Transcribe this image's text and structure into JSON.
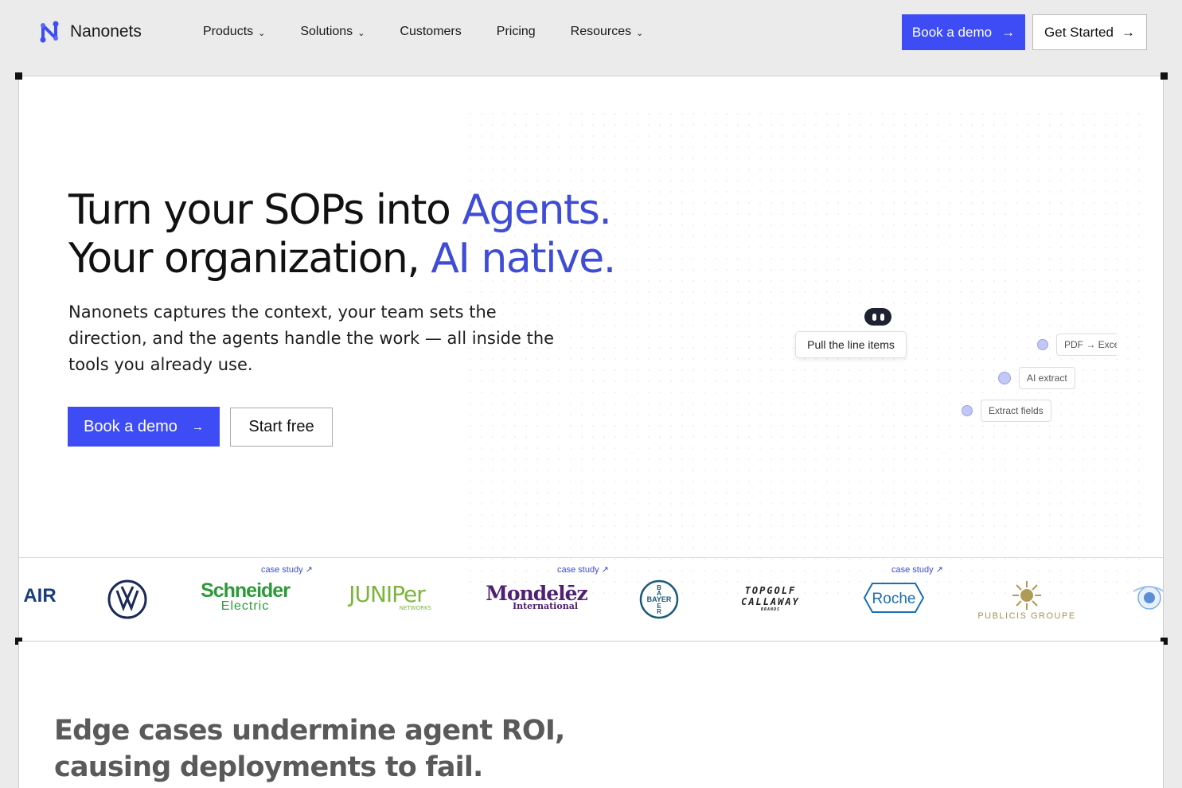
{
  "nav": {
    "brand": "Nanonets",
    "menu": [
      {
        "label": "Products",
        "dropdown": true
      },
      {
        "label": "Solutions",
        "dropdown": true
      },
      {
        "label": "Customers",
        "dropdown": false
      },
      {
        "label": "Pricing",
        "dropdown": false
      },
      {
        "label": "Resources",
        "dropdown": true
      }
    ],
    "book_demo": "Book a demo",
    "get_started": "Get Started"
  },
  "hero": {
    "line1_plain": "Turn your SOPs into ",
    "line1_accent": "Agents.",
    "line2_plain": "Your organization, ",
    "line2_accent": "AI native.",
    "subtitle": "Nanonets captures the context, your team sets the direction, and the agents handle the work — all inside the tools you already use.",
    "cta_primary": "Book a demo",
    "cta_secondary": "Start free"
  },
  "workflow": {
    "bubble": "Pull the line items",
    "steps": [
      "PDF → Exce",
      "AI extract",
      "Extract fields"
    ]
  },
  "logos": {
    "case_study_label": "case study ↗",
    "items": [
      "AIR",
      "VW",
      "Schneider Electric",
      "JUNIPER NETWORKS",
      "Mondelēz International",
      "BAYER",
      "TOPGOLF CALLAWAY BRANDS",
      "Roche",
      "PUBLICIS GROUPE"
    ]
  },
  "section2": {
    "title_line1": "Edge cases undermine agent ROI,",
    "title_line2": "causing deployments to fail."
  },
  "colors": {
    "accent": "#3e4cf5",
    "accent_text": "#3e4cd6",
    "background": "#ebebeb"
  }
}
